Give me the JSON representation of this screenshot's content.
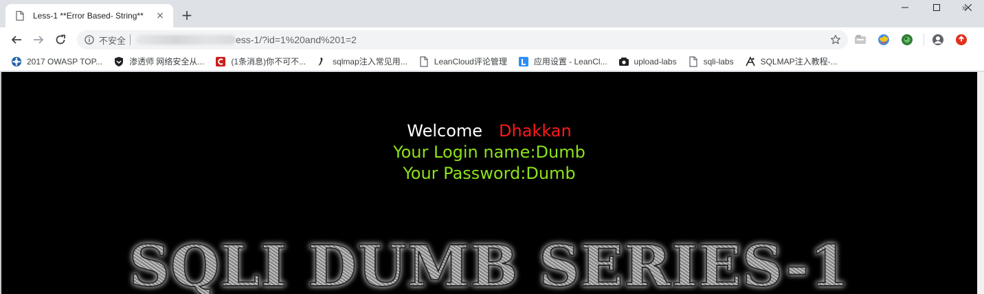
{
  "tab": {
    "title": "Less-1 **Error Based- String**",
    "close_glyph": "×"
  },
  "new_tab_glyph": "+",
  "window_controls": {
    "minimize": "—",
    "maximize": "☐",
    "close": "✕"
  },
  "omnibox": {
    "security_label": "不安全",
    "url": "ess-1/?id=1%20and%201=2"
  },
  "bookmarks": [
    {
      "label": "2017 OWASP TOP...",
      "icon": "owasp-icon"
    },
    {
      "label": "渗透师 网络安全从...",
      "icon": "shield-icon"
    },
    {
      "label": "(1条消息)你不可不...",
      "icon": "csdn-icon"
    },
    {
      "label": "sqlmap注入常见用...",
      "icon": "pen-icon"
    },
    {
      "label": "LeanCloud评论管理",
      "icon": "page-icon"
    },
    {
      "label": "应用设置 - LeanCl...",
      "icon": "leancloud-icon"
    },
    {
      "label": "upload-labs",
      "icon": "github-icon"
    },
    {
      "label": "sqli-labs",
      "icon": "page-icon"
    },
    {
      "label": "SQLMAP注入教程-...",
      "icon": "sqlmap-icon"
    }
  ],
  "bookmarks_more": "»",
  "page": {
    "welcome": "Welcome",
    "username": "Dhakkan",
    "login_line": "Your Login name:Dumb",
    "password_line": "Your Password:Dumb",
    "banner": "SQLI DUMB SERIES-1"
  },
  "colors": {
    "page_bg": "#000000",
    "welcome": "#ffffff",
    "username": "#ff1a1a",
    "result": "#8de11a"
  }
}
